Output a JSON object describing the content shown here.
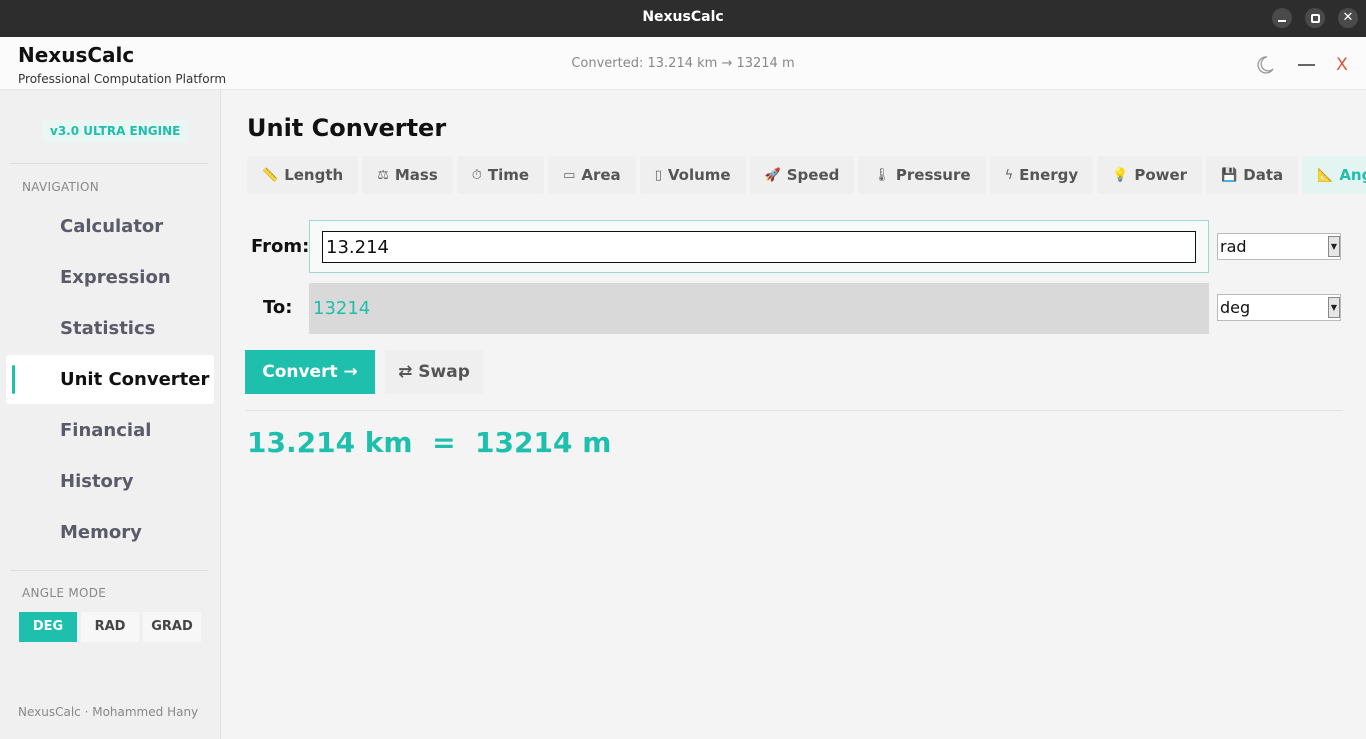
{
  "window": {
    "title": "NexusCalc"
  },
  "header": {
    "brand": "NexusCalc",
    "tagline": "Professional Computation Platform",
    "status": "Converted: 13.214 km → 13214 m",
    "close_glyph": "X"
  },
  "sidebar": {
    "version_badge": "v3.0  ULTRA ENGINE",
    "nav_heading": "NAVIGATION",
    "nav_items": [
      {
        "label": "Calculator"
      },
      {
        "label": "Expression"
      },
      {
        "label": "Statistics"
      },
      {
        "label": "Unit Converter",
        "active": true
      },
      {
        "label": "Financial"
      },
      {
        "label": "History"
      },
      {
        "label": "Memory"
      }
    ],
    "angle_heading": "ANGLE MODE",
    "angle_modes": [
      {
        "label": "DEG",
        "active": true
      },
      {
        "label": "RAD"
      },
      {
        "label": "GRAD"
      }
    ],
    "footer": "NexusCalc · Mohammed Hany"
  },
  "main": {
    "title": "Unit Converter",
    "tabs": [
      {
        "label": "Length",
        "icon": "ruler-icon",
        "glyph": "📏"
      },
      {
        "label": "Mass",
        "icon": "scale-icon",
        "glyph": "⚖"
      },
      {
        "label": "Time",
        "icon": "clock-icon",
        "glyph": "⏱"
      },
      {
        "label": "Area",
        "icon": "rectangle-icon",
        "glyph": "▭"
      },
      {
        "label": "Volume",
        "icon": "container-icon",
        "glyph": "▯"
      },
      {
        "label": "Speed",
        "icon": "rocket-icon",
        "glyph": "🚀"
      },
      {
        "label": "Pressure",
        "icon": "thermometer-icon",
        "glyph": "🌡"
      },
      {
        "label": "Energy",
        "icon": "lightning-icon",
        "glyph": "ϟ"
      },
      {
        "label": "Power",
        "icon": "bulb-icon",
        "glyph": "💡"
      },
      {
        "label": "Data",
        "icon": "floppy-disk-icon",
        "glyph": "💾"
      },
      {
        "label": "Angle",
        "icon": "triangle-ruler-icon",
        "glyph": "📐",
        "active": true
      }
    ],
    "from_label": "From:",
    "from_value": "13.214",
    "from_unit": "rad",
    "to_label": "To:",
    "to_value": "13214",
    "to_unit": "deg",
    "convert_label": "Convert →",
    "swap_label": "⇄ Swap",
    "result": "13.214 km  =  13214 m",
    "accent_color": "#1fbfae"
  }
}
